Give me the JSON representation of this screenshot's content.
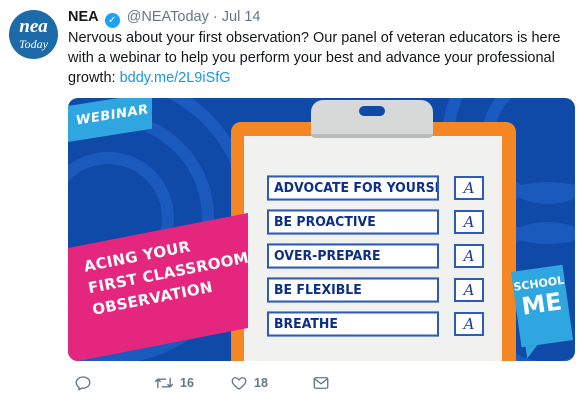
{
  "avatar": {
    "logo_line1": "nea",
    "logo_line2": "Today"
  },
  "header": {
    "name": "NEA",
    "handle": "@NEAToday",
    "separator": "·",
    "date": "Jul 14"
  },
  "tweet": {
    "text": "Nervous about your first observation? Our panel of veteran educators is here with a webinar to help you perform your best and advance your professional growth: ",
    "link": "bddy.me/2L9iSfG"
  },
  "media": {
    "badge": "WEBINAR",
    "headline": [
      "ACING YOUR",
      "FIRST CLASSROOM",
      "OBSERVATION"
    ],
    "checklist": [
      {
        "item": "ADVOCATE FOR YOURSELF",
        "grade": "A"
      },
      {
        "item": "BE PROACTIVE",
        "grade": "A"
      },
      {
        "item": "OVER-PREPARE",
        "grade": "A"
      },
      {
        "item": "BE FLEXIBLE",
        "grade": "A"
      },
      {
        "item": "BREATHE",
        "grade": "A"
      }
    ],
    "corner_logo": {
      "line1": "SCHOOL",
      "line2": "ME"
    },
    "colors": {
      "background": "#0f4aa8",
      "accent_pink": "#e5267e",
      "accent_orange": "#f58624",
      "accent_blue": "#2fa6e0"
    }
  },
  "actions": {
    "reply_icon": "reply-icon",
    "retweet_icon": "retweet-icon",
    "retweet_count": "16",
    "like_icon": "heart-icon",
    "like_count": "18",
    "dm_icon": "envelope-icon"
  }
}
